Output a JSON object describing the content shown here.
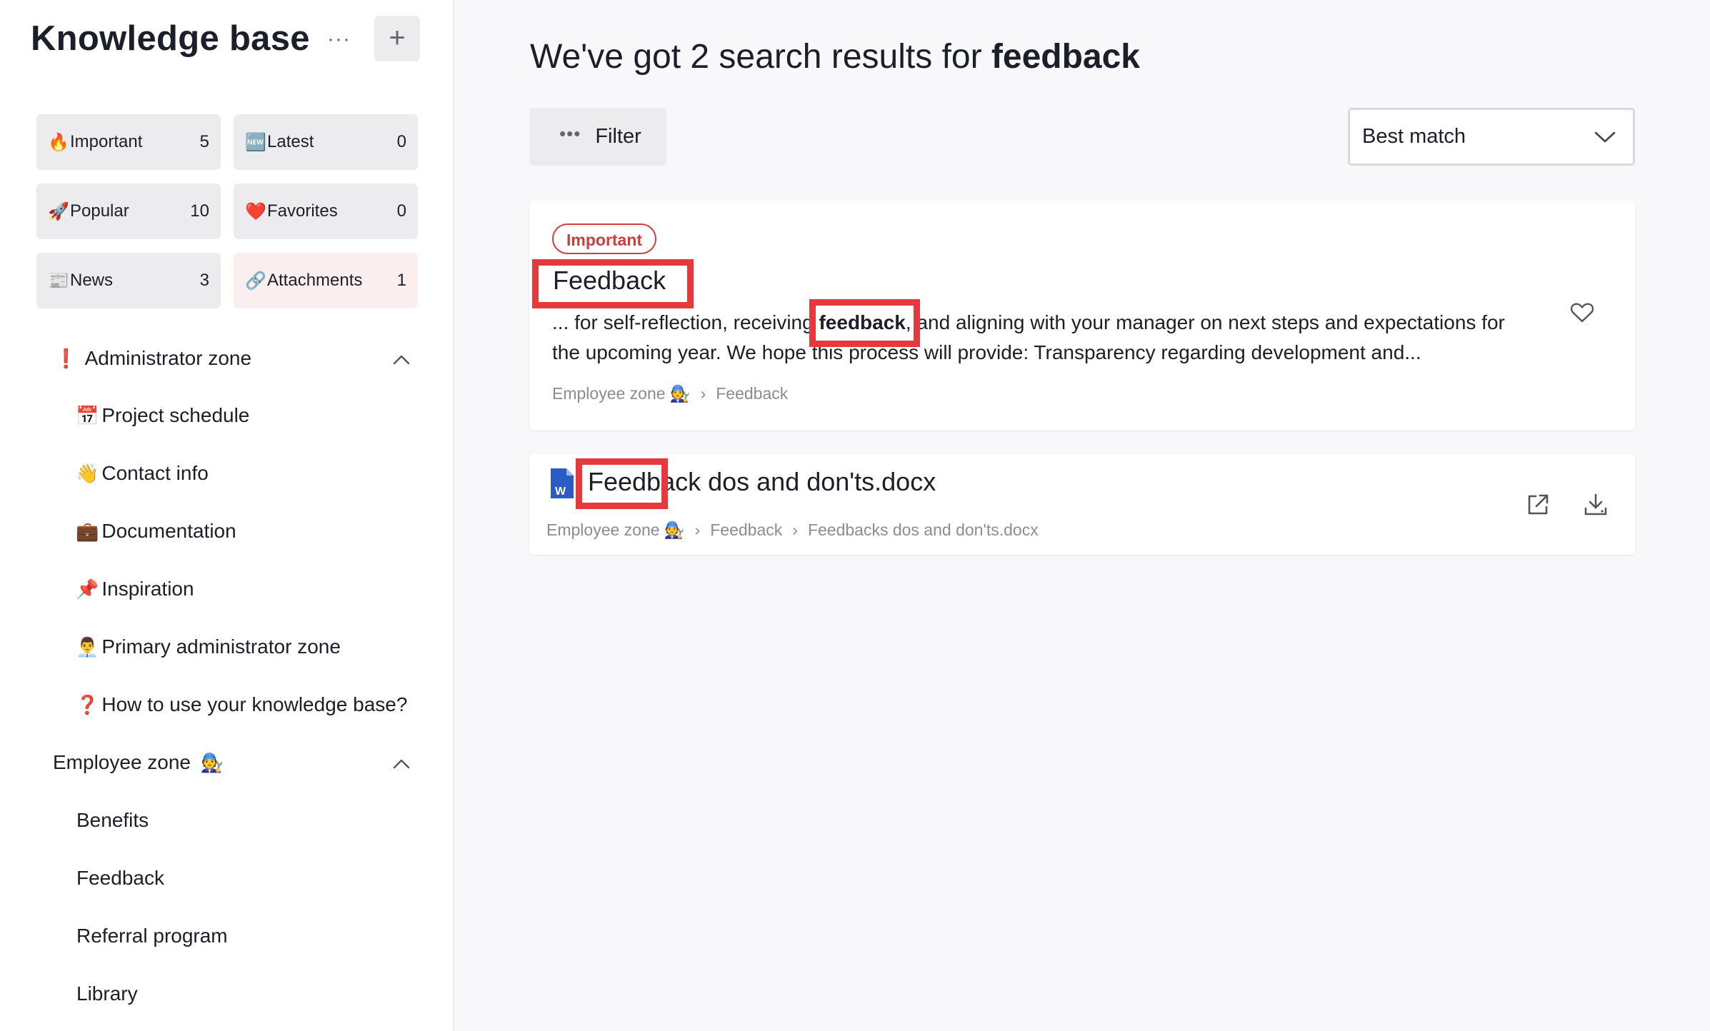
{
  "sidebar": {
    "title": "Knowledge base",
    "more_label": "···",
    "add_label": "+",
    "tiles": [
      {
        "icon": "🔥",
        "label": "Important",
        "count": "5"
      },
      {
        "icon": "🆕",
        "label": "Latest",
        "count": "0"
      },
      {
        "icon": "🚀",
        "label": "Popular",
        "count": "10"
      },
      {
        "icon": "❤️",
        "label": "Favorites",
        "count": "0"
      },
      {
        "icon": "📰",
        "label": "News",
        "count": "3"
      },
      {
        "icon": "🔗",
        "label": "Attachments",
        "count": "1"
      }
    ],
    "admin_zone": {
      "icon": "❗",
      "label": "Administrator zone",
      "items": [
        {
          "icon": "📅",
          "label": "Project schedule"
        },
        {
          "icon": "👋",
          "label": "Contact info"
        },
        {
          "icon": "💼",
          "label": "Documentation"
        },
        {
          "icon": "📌",
          "label": "Inspiration"
        },
        {
          "icon": "👨‍💼",
          "label": "Primary administrator zone"
        },
        {
          "icon": "❓",
          "label": "How to use your knowledge base?"
        }
      ]
    },
    "employee_zone": {
      "label": "Employee zone",
      "icon": "🧑‍🔧",
      "items": [
        {
          "label": "Benefits"
        },
        {
          "label": "Feedback"
        },
        {
          "label": "Referral program"
        },
        {
          "label": "Library"
        }
      ]
    }
  },
  "main": {
    "title_prefix": "We've got 2 search results for ",
    "query": "feedback",
    "filter_label": "Filter",
    "sort_label": "Best match",
    "results": [
      {
        "badge": "Important",
        "title": "Feedback",
        "snippet_before": "... for self-reflection, receiving ",
        "snippet_match": "feedback",
        "snippet_after": ", and aligning with your manager on next steps and expectations for the upcoming year. We hope this process will provide: Transparency regarding development and...",
        "crumbs": [
          "Employee zone 🧑‍🔧",
          "Feedback"
        ],
        "crumb_sep": "›"
      },
      {
        "file_icon_letter": "W",
        "title_match": "Feedback",
        "title_rest": " dos and don'ts.docx",
        "crumbs": [
          "Employee zone 🧑‍🔧",
          "Feedback",
          "Feedbacks dos and don'ts.docx"
        ],
        "crumb_sep": "›"
      }
    ]
  },
  "colors": {
    "accent_red": "#e5393e",
    "tile_bg": "#ececef",
    "attachments_tile_bg": "#fbeeef",
    "word_blue": "#2b5cc6"
  }
}
